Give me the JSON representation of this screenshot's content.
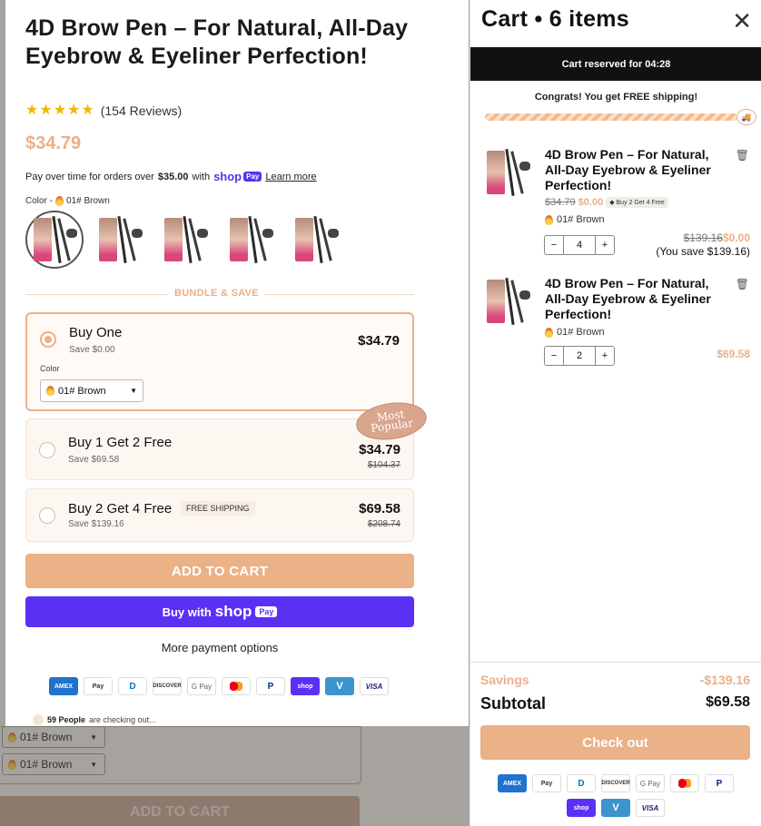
{
  "background": {
    "variant_1": "01# Brown",
    "variant_2": "01# Brown",
    "add_to_cart": "ADD TO CART"
  },
  "product": {
    "title": "4D Brow Pen – For Natural, All-Day Eyebrow & Eyeliner Perfection!",
    "rating": 5,
    "reviews": "(154 Reviews)",
    "price": "$34.79",
    "pay_over_prefix": "Pay over time for orders over",
    "pay_over_amount": "$35.00",
    "pay_over_with": "with",
    "learn_more": "Learn more",
    "color_label": "Color -",
    "color_value": "01# Brown",
    "swatch_count": 5,
    "bundle_label": "BUNDLE & SAVE",
    "offers": [
      {
        "name": "Buy One",
        "save": "Save $0.00",
        "price": "$34.79",
        "strike": "",
        "badge": "",
        "color_label": "Color",
        "color_value": "01# Brown",
        "selected": true
      },
      {
        "name": "Buy 1 Get 2 Free",
        "save": "Save $69.58",
        "price": "$34.79",
        "strike": "$104.37",
        "badge": "",
        "selected": false
      },
      {
        "name": "Buy 2 Get 4 Free",
        "save": "Save $139.16",
        "price": "$69.58",
        "strike": "$208.74",
        "badge": "FREE SHIPPING",
        "selected": false
      }
    ],
    "popular_badge_1": "Most",
    "popular_badge_2": "Popular",
    "add_to_cart": "ADD TO CART",
    "buy_with": "Buy with",
    "shop_logo": "shop",
    "pay": "Pay",
    "more_payment": "More payment options",
    "checking_count": "59 People",
    "checking_text": "are checking out..."
  },
  "payment_icons": [
    {
      "name": "amex-icon",
      "label": "AMEX",
      "cls": "amex"
    },
    {
      "name": "apple-pay-icon",
      "label": "Pay",
      "cls": "apple"
    },
    {
      "name": "diners-icon",
      "label": "D",
      "cls": "diners"
    },
    {
      "name": "discover-icon",
      "label": "DISCOVER",
      "cls": "disc"
    },
    {
      "name": "google-pay-icon",
      "label": "G Pay",
      "cls": "gpay"
    },
    {
      "name": "mastercard-icon",
      "label": "",
      "cls": "mc"
    },
    {
      "name": "paypal-icon",
      "label": "P",
      "cls": "pp"
    },
    {
      "name": "shop-pay-icon",
      "label": "shop",
      "cls": "shop"
    },
    {
      "name": "venmo-icon",
      "label": "V",
      "cls": "venmo"
    },
    {
      "name": "visa-icon",
      "label": "VISA",
      "cls": "visa"
    }
  ],
  "cart": {
    "title": "Cart • 6 items",
    "reserved": "Cart reserved for 04:28",
    "congrats": "Congrats! You get FREE shipping!",
    "shipping_progress": 1.0,
    "items": [
      {
        "title": "4D Brow Pen – For Natural, All-Day Eyebrow & Eyeliner Perfection!",
        "orig": "$34.79",
        "price": "$0.00",
        "tag": "Buy 2 Get 4 Free",
        "variant": "01# Brown",
        "qty": "4",
        "line_strike": "$139.16",
        "line_price": "$0.00",
        "line_save": "(You save $139.16)"
      },
      {
        "title": "4D Brow Pen – For Natural, All-Day Eyebrow & Eyeliner Perfection!",
        "variant": "01# Brown",
        "qty": "2",
        "line_price": "$69.58"
      }
    ],
    "savings_label": "Savings",
    "savings_value": "-$139.16",
    "subtotal_label": "Subtotal",
    "subtotal_value": "$69.58",
    "checkout": "Check out"
  },
  "colors": {
    "accent": "#ebb187",
    "shop_pay": "#5a31f4",
    "dark": "#111111"
  }
}
